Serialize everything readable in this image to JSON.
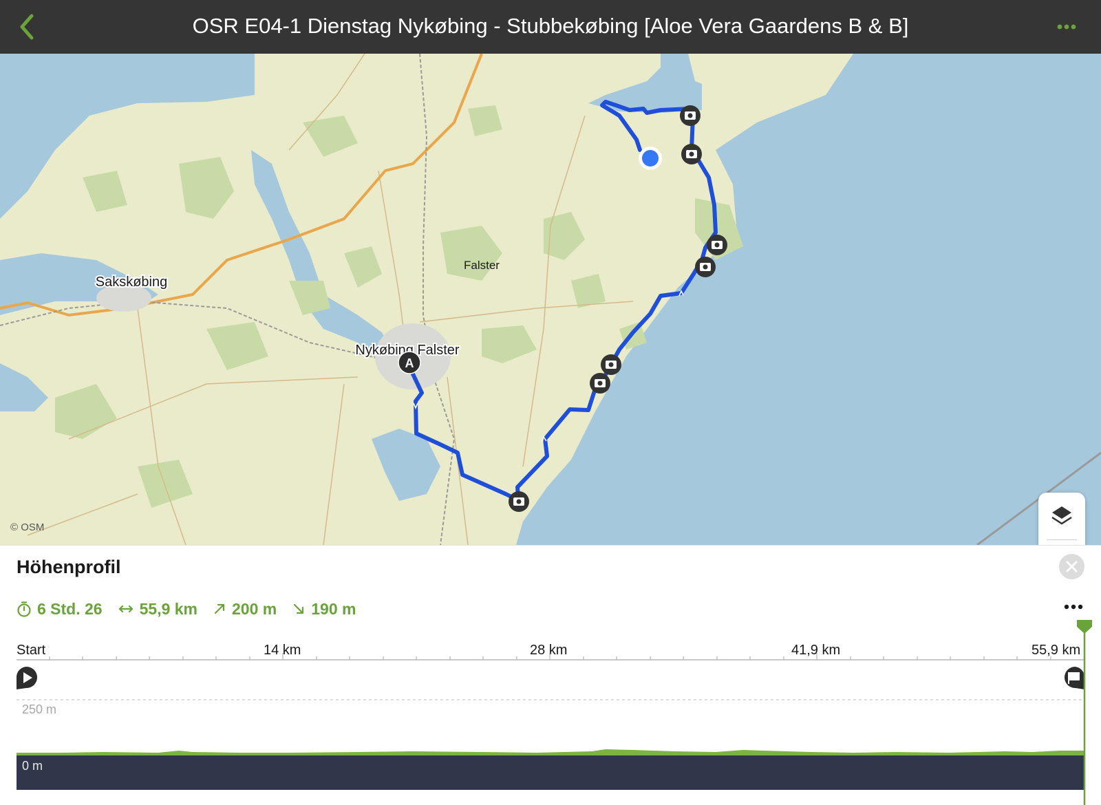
{
  "header": {
    "title": "OSR E04-1 Dienstag Nykøbing - Stubbekøbing [Aloe Vera Gaardens B & B]",
    "back_icon": "chevron-left-icon",
    "more_icon": "more-dots-icon"
  },
  "map": {
    "labels": {
      "falster": "Falster",
      "sakskobing": "Sakskøbing",
      "nykobing": "Nykøbing Falster"
    },
    "start_marker": "A",
    "attribution": "© OSM"
  },
  "profile_panel": {
    "title": "Höhenprofil",
    "stats": {
      "duration": "6 Std. 26",
      "distance": "55,9 km",
      "ascent": "200 m",
      "descent": "190 m"
    },
    "axis": [
      "Start",
      "14 km",
      "28 km",
      "41,9 km",
      "55,9 km"
    ],
    "elevation_labels": {
      "top": "250 m",
      "bottom": "0 m"
    }
  },
  "colors": {
    "accent": "#6aa33a",
    "route": "#1f4ed8",
    "header_bg": "#353535",
    "water": "#a6c8dd",
    "land": "#e9ebcb"
  }
}
